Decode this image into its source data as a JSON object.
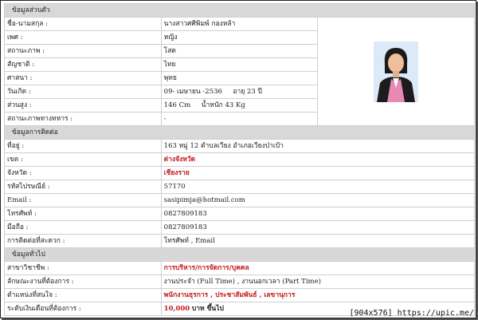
{
  "sections": {
    "personal": "ข้อมูลส่วนตัว",
    "contact": "ข้อมูลการติดต่อ",
    "general": "ข้อมูลทั่วไป"
  },
  "personal": [
    {
      "label": "ชื่อ-นามสกุล :",
      "value": "นางสาวศศิพิมพ์ กองหล้า"
    },
    {
      "label": "เพศ :",
      "value": "หญิง"
    },
    {
      "label": "สถานะภาพ :",
      "value": "โสด"
    },
    {
      "label": "สัญชาติ :",
      "value": "ไทย"
    },
    {
      "label": "ศาสนา :",
      "value": "พุทธ"
    },
    {
      "label": "วันเกิด :",
      "value": "09- เมษายน -2536     อายุ 23 ปี"
    },
    {
      "label": "ส่วนสูง :",
      "value": "146 Cm     น้ำหนัก 43 Kg"
    },
    {
      "label": "สถานะภาพทางทหาร :",
      "value": "-"
    }
  ],
  "contact": [
    {
      "label": "ที่อยู่ :",
      "value": "163 หมู่ 12 ตำบลเวียง อำเภอเวียงป่าเป้า"
    },
    {
      "label": "เขต :",
      "value": "ต่างจังหวัด"
    },
    {
      "label": "จังหวัด :",
      "value": "เชียงราย"
    },
    {
      "label": "รหัสไปรษณีย์ :",
      "value": "57170"
    },
    {
      "label": "Email :",
      "value": "sasipimja@hotmail.com"
    },
    {
      "label": "โทรศัพท์ :",
      "value": "0827809183"
    },
    {
      "label": "มือถือ :",
      "value": "0827809183"
    },
    {
      "label": "การติดต่อที่สะดวก :",
      "value": "โทรศัพท์ , Email"
    }
  ],
  "general": [
    {
      "label": "สาขาวิชาชีพ :",
      "value": "การบริหาร/การจัดการ/บุคคล"
    },
    {
      "label": "ลักษณะงานที่ต้องการ :",
      "value": "งานประจำ (Full Time) , งานนอกเวลา (Part Time)"
    },
    {
      "label": "ตำแหน่งที่สนใจ :",
      "value": "พนักงานธุรการ , ประชาสัมพันธ์ , เลขานุการ"
    },
    {
      "label": "ระดับเงินเดือนที่ต้องการ :",
      "salary": "10,000",
      "salary_unit": "บาท ขึ้นไป"
    }
  ],
  "watermark": "[904x576] https://upic.me/",
  "colors": {
    "section_bg": "#d8d8d8",
    "highlight": "#c21b1b",
    "border": "#cfcfcf"
  }
}
